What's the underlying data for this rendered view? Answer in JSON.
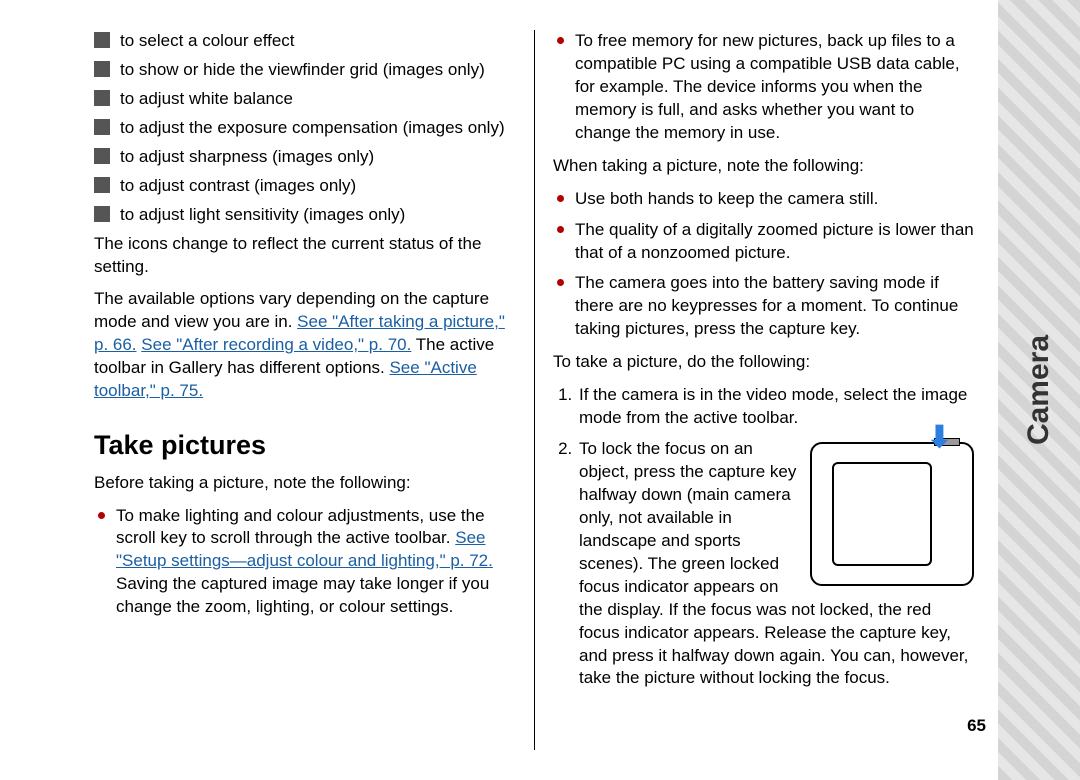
{
  "sidebar": {
    "label": "Camera"
  },
  "page_number": "65",
  "left": {
    "icons": [
      {
        "text": "to select a colour effect"
      },
      {
        "text": " to show or hide the viewfinder grid (images only)",
        "wrap": true
      },
      {
        "text": "to adjust white balance"
      },
      {
        "text": "to adjust the exposure compensation (images only)",
        "wrap": true
      },
      {
        "text": "to adjust sharpness (images only)"
      },
      {
        "text": "to adjust contrast (images only)"
      },
      {
        "text": "to adjust light sensitivity (images only)"
      }
    ],
    "p1": "The icons change to reflect the current status of the setting.",
    "p2_a": "The available options vary depending on the capture mode and view you are in. ",
    "p2_link1": "See \"After taking a picture,\" p. 66.",
    "p2_b": " ",
    "p2_link2": "See \"After recording a video,\" p. 70.",
    "p2_c": " The active toolbar in Gallery has different options. ",
    "p2_link3": "See \"Active toolbar,\" p. 75.",
    "heading": "Take pictures",
    "p3": "Before taking a picture, note the following:",
    "bullets": [
      {
        "a": "To make lighting and colour adjustments, use the scroll key to scroll through the active toolbar. ",
        "link": "See \"Setup settings—adjust colour and lighting,\" p. 72.",
        "b": " Saving the captured image may take longer if you change the zoom, lighting, or colour settings."
      }
    ]
  },
  "right": {
    "bullets1": [
      {
        "text": "To free memory for new pictures, back up files to a compatible PC using a compatible USB data cable, for example. The device informs you when the memory is full, and asks whether you want to change the memory in use."
      }
    ],
    "p1": "When taking a picture, note the following:",
    "bullets2": [
      {
        "text": "Use both hands to keep the camera still."
      },
      {
        "text": "The quality of a digitally zoomed picture is lower than that of a nonzoomed picture."
      },
      {
        "text": "The camera goes into the battery saving mode if there are no keypresses for a moment. To continue taking pictures, press the capture key."
      }
    ],
    "p2": "To take a picture, do the following:",
    "steps": [
      {
        "text": "If the camera is in the video mode, select the image mode from the active toolbar."
      },
      {
        "text": "To lock the focus on an object, press the capture key halfway down (main camera only, not available in landscape and sports scenes). The green locked focus indicator appears on the display. If the focus was not locked, the red focus indicator appears. Release the capture key, and press it halfway down again. You can, however, take the picture without locking the focus.",
        "figure": true
      }
    ]
  }
}
